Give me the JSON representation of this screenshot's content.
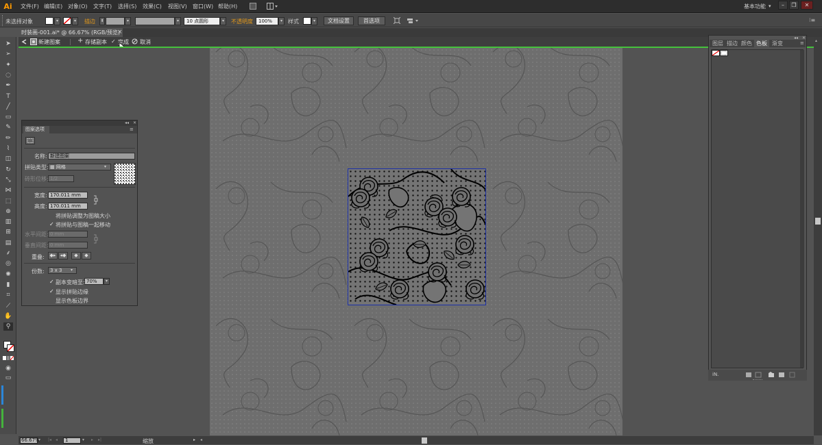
{
  "app": {
    "logo": "Ai",
    "workspace": "基本功能"
  },
  "menu": [
    "文件(F)",
    "编辑(E)",
    "对象(O)",
    "文字(T)",
    "选择(S)",
    "效果(C)",
    "视图(V)",
    "窗口(W)",
    "帮助(H)"
  ],
  "window_controls": {
    "minimize": "–",
    "restore": "❐",
    "close": "✕"
  },
  "control_bar": {
    "selection_status": "未选择对象",
    "stroke_label": "描边",
    "brush_value": "10 点圆形",
    "opacity_label": "不透明度",
    "opacity_value": "100%",
    "style_label": "样式",
    "doc_setup_button": "文档设置",
    "prefs_button": "首选项"
  },
  "document_tab": {
    "title": "时装画-001.ai* @ 66.67% (RGB/预览)",
    "close": "×"
  },
  "pattern_bar": {
    "name": "新建图案",
    "save_copy": "存储副本",
    "done": "完成",
    "cancel": "取消"
  },
  "pattern_options": {
    "title": "图案选项",
    "name_label": "名称:",
    "name_value": "新建图案",
    "tile_type_label": "拼贴类型:",
    "tile_type_value": "网格",
    "brick_offset_label": "砖形位移:",
    "brick_offset_value": "1/2",
    "width_label": "宽度:",
    "width_value": "170.011 mm",
    "height_label": "高度:",
    "height_value": "170.011 mm",
    "size_to_art_label": "将拼贴调整为图稿大小",
    "size_to_art_checked": false,
    "move_with_art_label": "将拼贴与图稿一起移动",
    "move_with_art_checked": true,
    "h_spacing_label": "水平间距:",
    "h_spacing_value": "0 mm",
    "v_spacing_label": "垂直间距:",
    "v_spacing_value": "0 mm",
    "overlap_label": "重叠:",
    "copies_label": "份数:",
    "copies_value": "3 x 3",
    "dim_copies_label": "副本变暗至:",
    "dim_copies_value": "70%",
    "dim_copies_checked": true,
    "show_tile_edge_label": "显示拼贴边缘",
    "show_tile_edge_checked": true,
    "show_swatch_bounds_label": "显示色板边界",
    "show_swatch_bounds_checked": false
  },
  "swatches_panel": {
    "tabs": [
      "图层",
      "描边",
      "颜色",
      "色板",
      "渐变"
    ],
    "active_tab": "色板",
    "library_menu": "iN."
  },
  "status_bar": {
    "zoom": "66.67%",
    "page": "1",
    "tool_name": "缩放"
  },
  "tools": [
    "selection-tool-icon",
    "direct-selection-tool-icon",
    "magic-wand-icon",
    "lasso-icon",
    "pen-tool-icon",
    "type-tool-icon",
    "line-tool-icon",
    "rectangle-tool-icon",
    "paintbrush-icon",
    "pencil-icon",
    "blob-brush-icon",
    "eraser-icon",
    "rotate-tool-icon",
    "scale-tool-icon",
    "width-tool-icon",
    "free-transform-icon",
    "shape-builder-icon",
    "perspective-grid-icon",
    "mesh-tool-icon",
    "gradient-tool-icon",
    "eyedropper-icon",
    "blend-tool-icon",
    "symbol-sprayer-icon",
    "column-graph-icon",
    "artboard-tool-icon",
    "slice-tool-icon",
    "hand-tool-icon",
    "zoom-tool-icon"
  ],
  "colors": {
    "tile_border": "#1c30a8",
    "guide_line": "#45c23c",
    "ai_logo": "#ff9a00"
  }
}
